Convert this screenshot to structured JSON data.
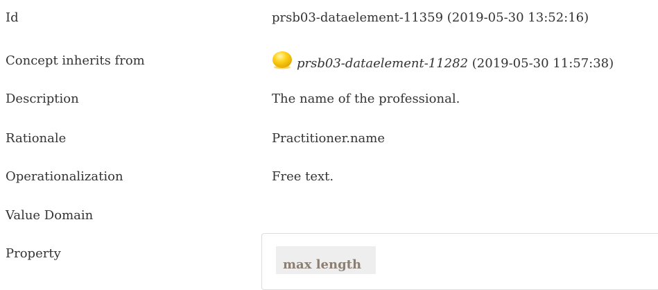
{
  "rows": {
    "id": {
      "label": "Id",
      "value": "prsb03-dataelement-11359 (2019-05-30 13:52:16)"
    },
    "inherits": {
      "label": "Concept inherits from",
      "link": "prsb03-dataelement-11282",
      "date": " (2019-05-30 11:57:38)",
      "icon": "yellow-status-orb-icon"
    },
    "description": {
      "label": "Description",
      "value": "The name of the professional."
    },
    "rationale": {
      "label": "Rationale",
      "value": "Practitioner.name"
    },
    "operationalization": {
      "label": "Operationalization",
      "value": "Free text."
    },
    "value_domain": {
      "label": "Value Domain"
    },
    "property": {
      "label": "Property",
      "header": "max length"
    }
  },
  "colors": {
    "text": "#333333",
    "chip_text": "#8a7f72",
    "chip_bg": "#eeeeee",
    "orb": "#f7c400"
  }
}
